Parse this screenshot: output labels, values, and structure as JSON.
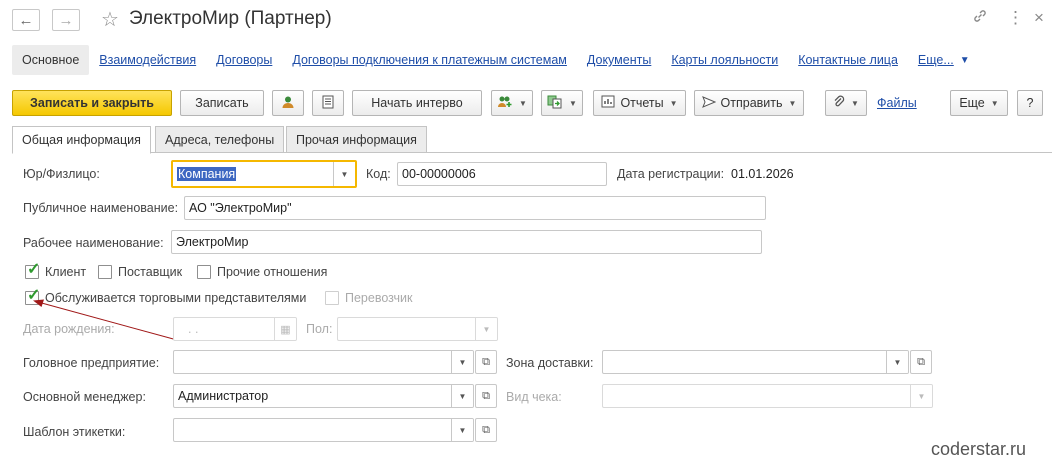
{
  "window": {
    "title": "ЭлектроМир (Партнер)",
    "back_icon": "arrow-left-icon",
    "forward_icon": "arrow-right-icon",
    "favorite_icon": "star-icon",
    "link_icon": "link-icon",
    "menu_icon": "more-vertical-icon",
    "close_icon": "close-icon"
  },
  "nav": {
    "items": [
      "Основное",
      "Взаимодействия",
      "Договоры",
      "Договоры подключения к платежным системам",
      "Документы",
      "Карты лояльности",
      "Контактные лица",
      "Еще..."
    ]
  },
  "toolbar": {
    "save_close": "Записать и закрыть",
    "save": "Записать",
    "user_icon": "user-icon",
    "report_icon": "document-icon",
    "interview": "Начать интерво",
    "group_icon": "add-users-icon",
    "create_icon": "create-based-icon",
    "reports": "Отчеты",
    "send": "Отправить",
    "attach_icon": "paperclip-icon",
    "files": "Файлы",
    "more": "Еще",
    "help": "?"
  },
  "tabs": [
    "Общая информация",
    "Адреса, телефоны",
    "Прочая информация"
  ],
  "form": {
    "legal_type_label": "Юр/Физлицо:",
    "legal_type_value": "Компания",
    "code_label": "Код:",
    "code_value": "00-00000006",
    "reg_date_label": "Дата регистрации:",
    "reg_date_value": "01.01.2026",
    "public_name_label": "Публичное наименование:",
    "public_name_value": "АО \"ЭлектроМир\"",
    "work_name_label": "Рабочее наименование:",
    "work_name_value": "ЭлектроМир",
    "client_label": "Клиент",
    "client_checked": true,
    "supplier_label": "Поставщик",
    "supplier_checked": false,
    "other_label": "Прочие отношения",
    "other_checked": false,
    "sales_reps_label": "Обслуживается торговыми представителями",
    "sales_reps_checked": true,
    "carrier_label": "Перевозчик",
    "carrier_checked": false,
    "birth_date_label": "Дата рождения:",
    "birth_date_value": ". .",
    "gender_label": "Пол:",
    "head_company_label": "Головное предприятие:",
    "delivery_zone_label": "Зона доставки:",
    "manager_label": "Основной менеджер:",
    "manager_value": "Администратор",
    "receipt_type_label": "Вид чека:",
    "label_template_label": "Шаблон этикетки:"
  },
  "watermark": "coderstar.ru",
  "colors": {
    "primary_button": "#f5c800",
    "link": "#1f4ea8",
    "focus_border": "#f5b800",
    "arrow": "#a01818",
    "checkmark": "#2f9a2f"
  }
}
